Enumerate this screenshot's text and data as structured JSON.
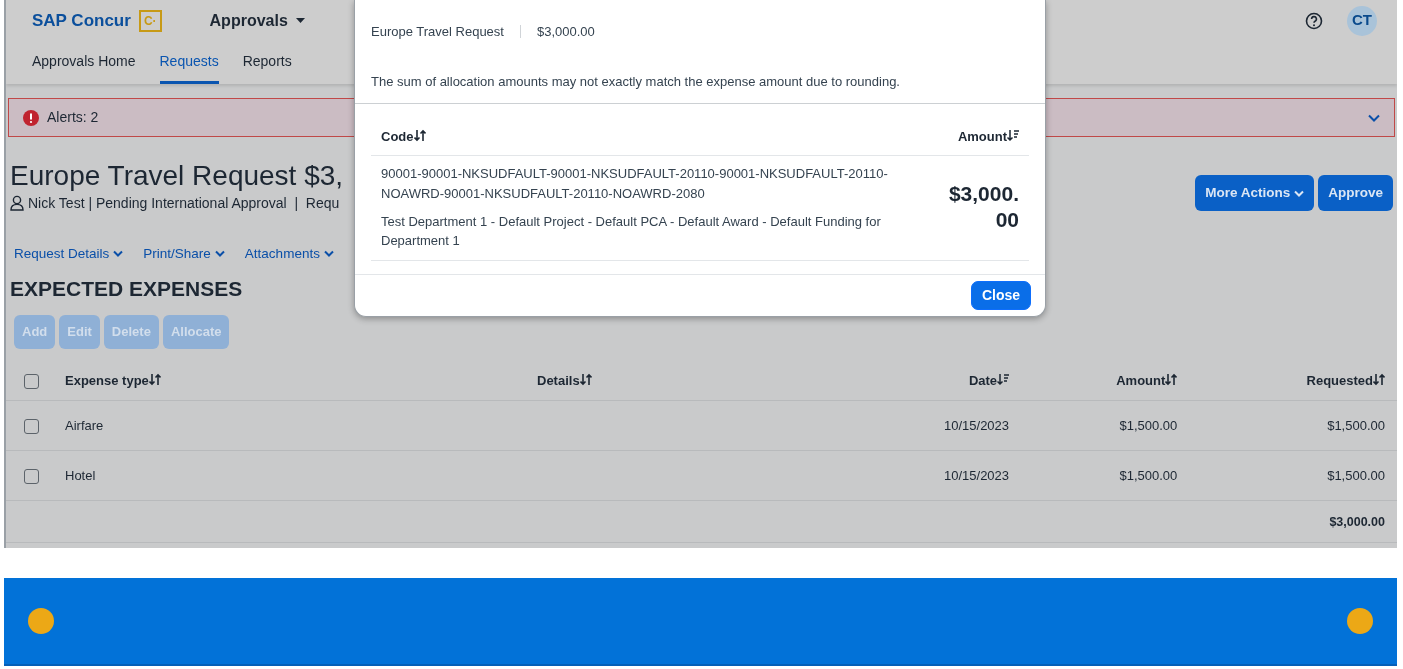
{
  "header": {
    "brand": "SAP Concur",
    "brand_mark": "C·",
    "app_menu": "Approvals",
    "avatar": "CT",
    "tabs": [
      {
        "label": "Approvals Home",
        "selected": false
      },
      {
        "label": "Requests",
        "selected": true
      },
      {
        "label": "Reports",
        "selected": false
      }
    ]
  },
  "alerts": {
    "label": "Alerts: 2",
    "expanded": false
  },
  "request": {
    "title": "Europe Travel Request $3,",
    "subtitle": "Nick Test | Pending International Approval  |  Requ",
    "actions": [
      "More Actions",
      "Approve"
    ],
    "links": [
      "Request Details",
      "Print/Share",
      "Attachments"
    ]
  },
  "expenses": {
    "heading": "EXPECTED EXPENSES",
    "select_all_checked": false,
    "buttons": [
      {
        "label": "Add",
        "disabled": true
      },
      {
        "label": "Edit",
        "disabled": true
      },
      {
        "label": "Delete",
        "disabled": true
      },
      {
        "label": "Allocate",
        "disabled": true
      }
    ],
    "columns": [
      {
        "label": "Expense type",
        "kind": "both"
      },
      {
        "label": "Details",
        "kind": "both"
      },
      {
        "label": "Date",
        "kind": "desc"
      },
      {
        "label": "Amount",
        "kind": "both"
      },
      {
        "label": "Requested",
        "kind": "both"
      }
    ],
    "rows": [
      {
        "checked": false,
        "cells": [
          "Airfare",
          "",
          "10/15/2023",
          "$1,500.00",
          "$1,500.00"
        ]
      },
      {
        "checked": false,
        "cells": [
          "Hotel",
          "",
          "10/15/2023",
          "$1,500.00",
          "$1,500.00"
        ]
      }
    ],
    "total": "$3,000.00"
  },
  "modal": {
    "request_name": "Europe Travel Request",
    "request_amount": "$3,000.00",
    "note": "The sum of allocation amounts may not exactly match the expense amount due to rounding.",
    "columns": [
      {
        "label": "Code",
        "kind": "both"
      },
      {
        "label": "Amount",
        "kind": "desc"
      }
    ],
    "rows": [
      {
        "code": "90001-90001-NKSUDFAULT-90001-NKSUDFAULT-20110-90001-NKSUDFAULT-20110-NOAWRD-90001-NKSUDFAULT-20110-NOAWRD-2080",
        "description": "Test Department 1 - Default Project - Default PCA - Default Award - Default Funding for Department 1",
        "amount": "$3,000.\n00"
      }
    ],
    "close": "Close"
  }
}
